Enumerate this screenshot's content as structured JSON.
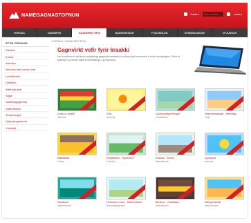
{
  "header": {
    "logo_text": "NAMEGAGNASTOFNUN",
    "link1": "Kaskur",
    "search_placeholder": "Mars-verbin",
    "link2": "Lokkur"
  },
  "nav": {
    "items": [
      {
        "label": "FORSIDA",
        "active": false
      },
      {
        "label": "NAMSEFNI",
        "active": false
      },
      {
        "label": "GAGNVIRKT EFNI",
        "active": false
      },
      {
        "label": "NAMSGREINAR",
        "active": false
      },
      {
        "label": "FJOLMIDLUN",
        "active": false
      },
      {
        "label": "KENNARASIDUR",
        "active": false
      },
      {
        "label": "NYJUNGAR",
        "active": false
      }
    ]
  },
  "sidebar": {
    "title": "EFTIR GREINUM",
    "items": [
      "Danska",
      "Enska",
      "Islenska",
      "Islenska sem annad mal",
      "Landafraedi",
      "Lifsleikni",
      "Natturufraedi",
      "Saga",
      "Samfelagsgreinar",
      "Staerdfraedi",
      "Trunarbrogd",
      "Upplysingamennt",
      "Ymislegt"
    ]
  },
  "main": {
    "breadcrumb": "FORSIDA / GAGNVIRKT EFNI",
    "hero_title": "Gagnvirkt vefir fyrir kraakki",
    "hero_text": "Her a vefnum er ad finna margvislegt gagnvirkt namsefni a vefnum fyrir nemendur a ollum skolastigum. Efnid er fjolbreytt og hentar bædi til einstaklings- og hopvinnu."
  },
  "tiles": [
    {
      "title": "Lestu ur andliti",
      "sub": "Islenska"
    },
    {
      "title": "Ordi",
      "sub": "Islenska"
    },
    {
      "title": "Ljosmyndagreiningin",
      "sub": "Landafraedi"
    },
    {
      "title": "Vestmannaeyjar - Heimaey",
      "sub": "Saga"
    },
    {
      "title": "Matarklaki",
      "sub": "Heilsa"
    },
    {
      "title": "Neytandinn - Sjonheyrn",
      "sub": "Lifsleikni"
    },
    {
      "title": "Klukkan - timinn",
      "sub": "Staerdfraedi"
    },
    {
      "title": "Ljosmynd",
      "sub": "Islenska"
    },
    {
      "title": "Sandkorn",
      "sub": "Natturufraedi"
    },
    {
      "title": "Heimurinn minn - Mannrettindi",
      "sub": "Samfelagsgreinar"
    },
    {
      "title": "Bankinn - Gullkistan",
      "sub": "Staerdfraedi"
    },
    {
      "title": "Mengunarmal",
      "sub": "Natturufraedi"
    }
  ],
  "colors": {
    "brand_red": "#d32027",
    "nav_dark": "#3d3d3d"
  }
}
